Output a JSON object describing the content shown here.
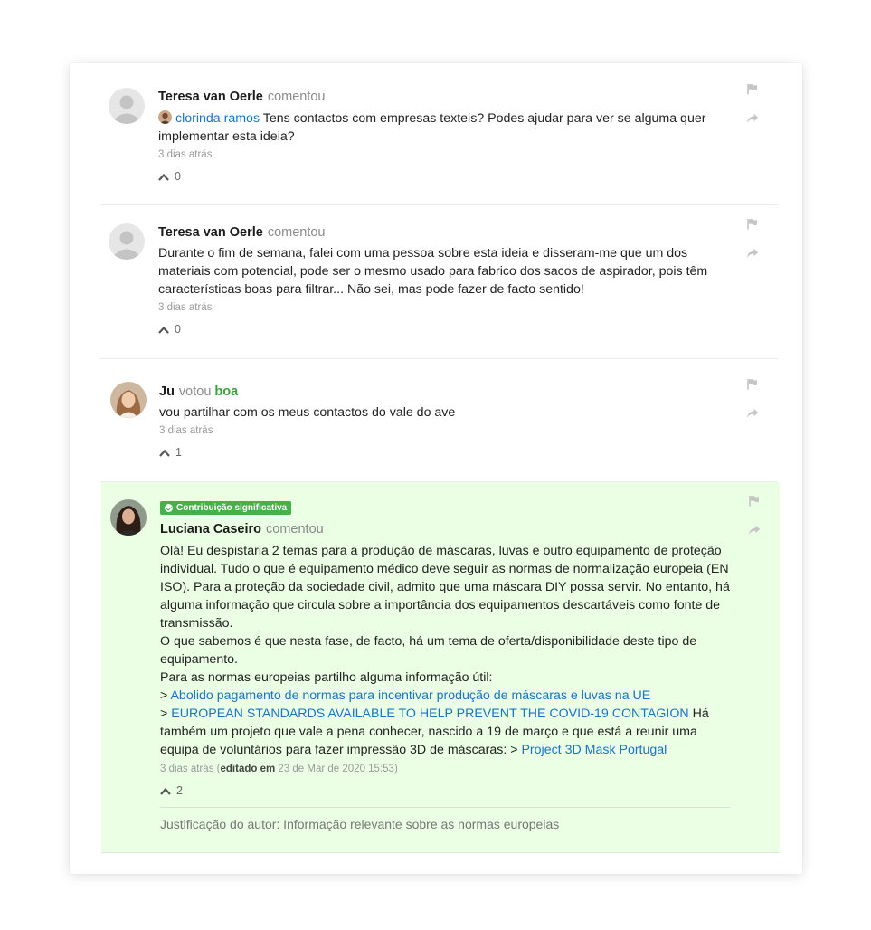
{
  "comments": [
    {
      "author": "Teresa van Oerle",
      "verb": "comentou",
      "mention": "clorinda ramos",
      "text": "Tens contactos com empresas texteis? Podes ajudar para ver se alguma quer implementar esta ideia?",
      "time": "3 dias atrás",
      "likes": "0"
    },
    {
      "author": "Teresa van Oerle",
      "verb": "comentou",
      "text": "Durante o fim de semana, falei com uma pessoa sobre esta ideia e disseram-me que um dos materiais com potencial, pode ser o mesmo usado para fabrico dos sacos de aspirador, pois têm características boas para filtrar... Não sei, mas pode fazer de facto sentido!",
      "time": "3 dias atrás",
      "likes": "0"
    },
    {
      "author": "Ju",
      "verb": "votou",
      "vote": "boa",
      "text": "vou partilhar com os meus contactos do vale do ave",
      "time": "3 dias atrás",
      "likes": "1"
    },
    {
      "badge": "Contribuição significativa",
      "author": "Luciana Caseiro",
      "verb": "comentou",
      "lines": [
        "Olá! Eu despistaria 2 temas para a produção de máscaras, luvas e outro equipamento de proteção individual. Tudo o que é equipamento médico deve seguir as normas de normalização europeia (EN ISO). Para a proteção da sociedade civil, admito que uma máscara DIY possa servir. No entanto, há alguma informação que circula sobre a importância dos equipamentos descartáveis como fonte de transmissão.",
        "O que sabemos é que nesta fase, de facto, há um tema de oferta/disponibilidade deste tipo de equipamento.",
        "Para as normas europeias partilho alguma informação útil:"
      ],
      "link_prefix": ">",
      "link1": "Abolido pagamento de normas para incentivar produção de máscaras e luvas na UE",
      "link2": "EUROPEAN STANDARDS AVAILABLE TO HELP PREVENT THE COVID-19 CONTAGION",
      "after_link2": "Há também um projeto que vale a pena conhecer, nascido a 19 de março e que está a reunir uma equipa de voluntários para fazer impressão 3D de máscaras:",
      "link3": "Project 3D Mask Portugal",
      "time": "3 dias atrás",
      "edited_open": "(",
      "edited_label": "editado em",
      "edited_date": "23 de Mar de 2020 15:53",
      "edited_close": ")",
      "likes": "2",
      "justification": "Justificação do autor: Informação relevante sobre as normas europeias"
    }
  ],
  "icons": {
    "flag": "flag-icon",
    "share": "share-icon",
    "upvote": "upvote-icon"
  },
  "colors": {
    "link": "#1a73c9",
    "highlight_bg": "#eaffe3",
    "badge": "#46b04a",
    "vote_value": "#3aa33a"
  }
}
